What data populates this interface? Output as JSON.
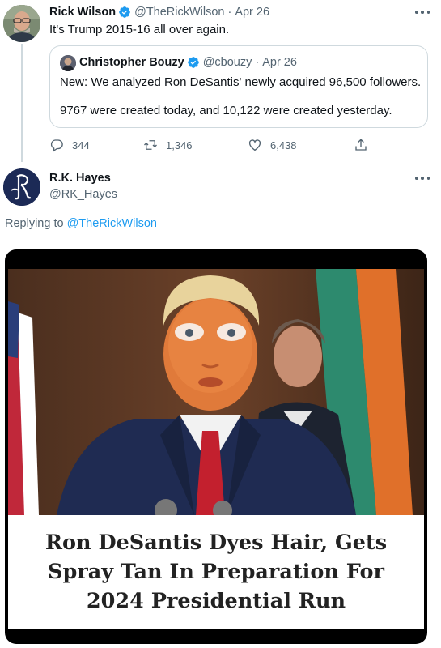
{
  "tweet1": {
    "name": "Rick Wilson",
    "handle": "@TheRickWilson",
    "separator": "·",
    "date": "Apr 26",
    "text": "It's Trump 2015-16 all over again."
  },
  "quote": {
    "name": "Christopher Bouzy",
    "handle": "@cbouzy",
    "separator": "·",
    "date": "Apr 26",
    "line1": "New: We analyzed Ron DeSantis' newly acquired 96,500 followers.",
    "line2": "9767 were created today, and 10,122 were created yesterday."
  },
  "actions": {
    "replies": "344",
    "retweets": "1,346",
    "likes": "6,438"
  },
  "tweet2": {
    "name": "R.K. Hayes",
    "handle": "@RK_Hayes",
    "reply_prefix": "Replying to ",
    "reply_handle": "@TheRickWilson"
  },
  "media": {
    "caption": "Ron DeSantis Dyes Hair, Gets Spray Tan In Preparation For 2024 Presidential Run"
  },
  "icons": [
    "verified-badge-icon",
    "more-icon",
    "reply-icon",
    "retweet-icon",
    "like-icon",
    "share-icon"
  ],
  "colors": {
    "link": "#1d9bf0",
    "muted": "#536471",
    "verified": "#1d9bf0",
    "border": "#cfd9de"
  }
}
